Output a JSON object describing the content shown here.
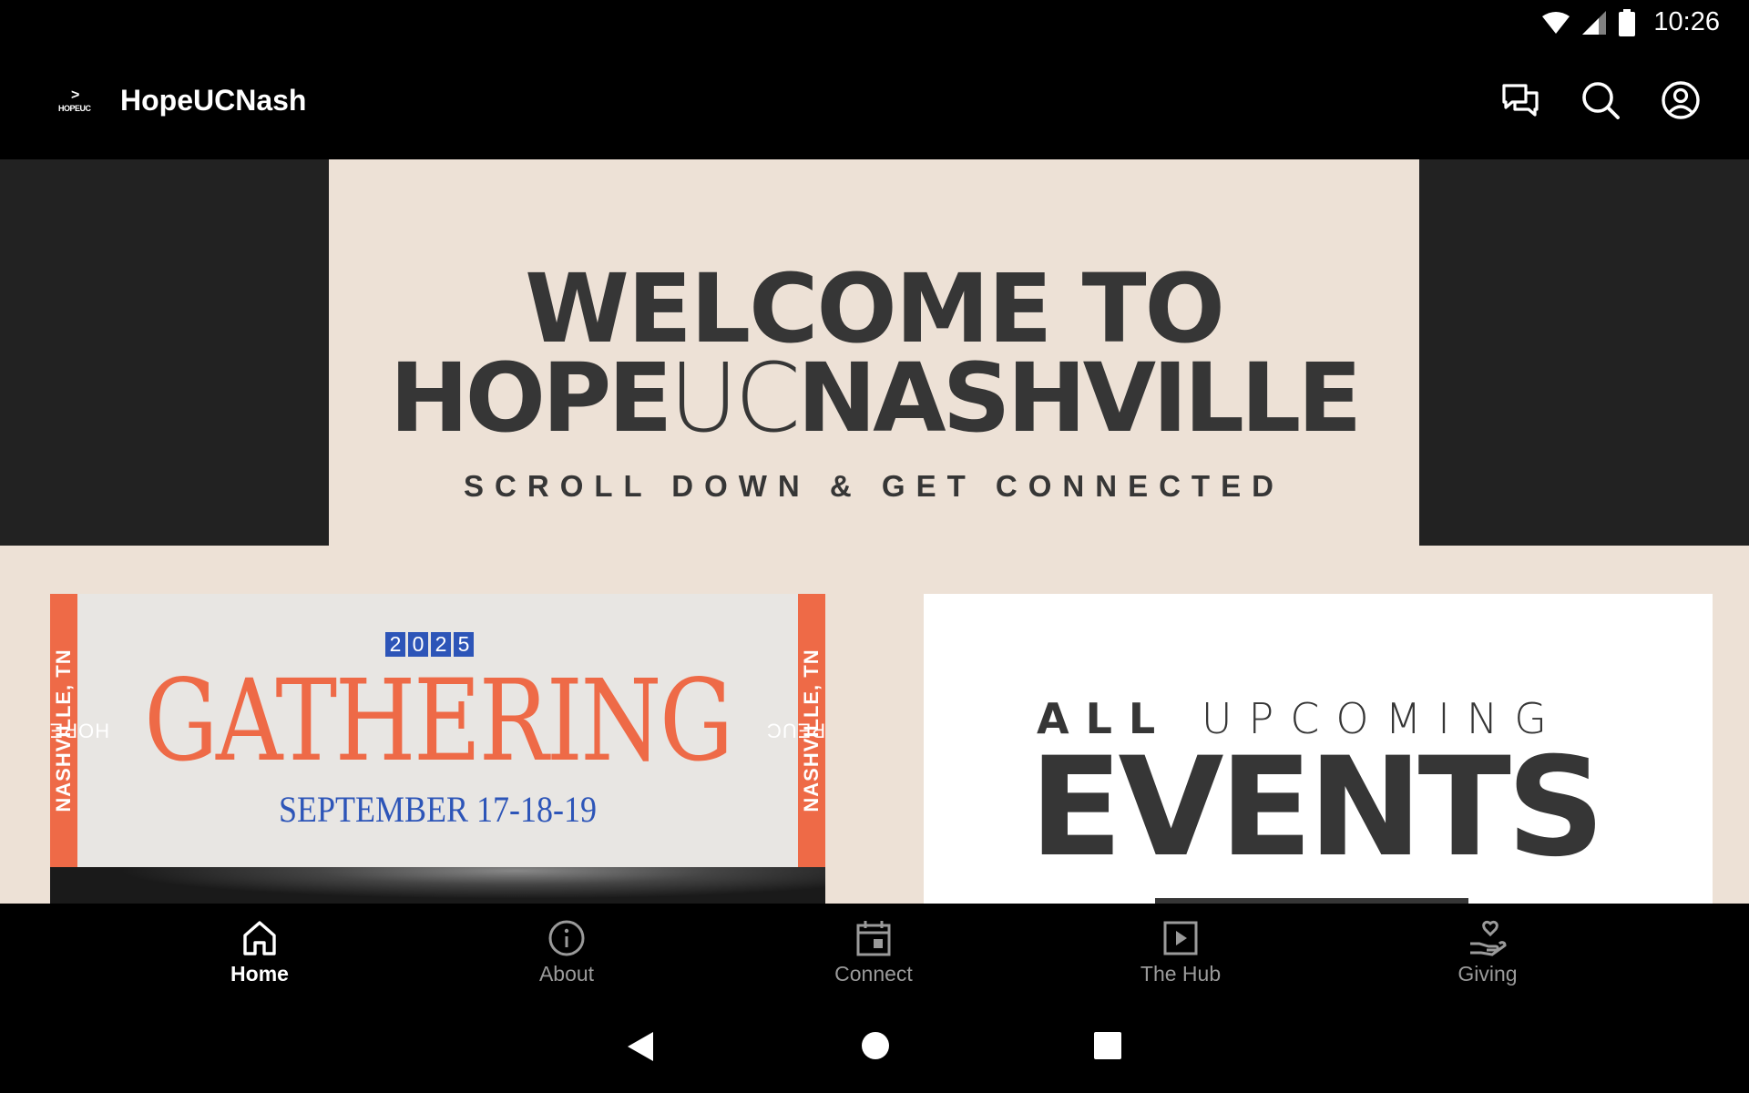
{
  "status_bar": {
    "time": "10:26"
  },
  "app_bar": {
    "logo_text": "HOPEUC",
    "title": "HopeUCNash"
  },
  "hero": {
    "line1": "WELCOME TO",
    "line2_bold_a": "HOPE",
    "line2_light": "UC",
    "line2_bold_b": "NASHVILLE",
    "subtitle": "SCROLL DOWN & GET CONNECTED"
  },
  "card_gathering": {
    "side_label_light": "HOPEUC ",
    "side_label_bold": "NASHVILLE, TN",
    "year_digits": [
      "2",
      "0",
      "2",
      "5"
    ],
    "title": "GATHERING",
    "date": "SEPTEMBER 17-18-19"
  },
  "card_events": {
    "line1_bold": "ALL",
    "line1_light": "UPCOMING",
    "line2": "EVENTS"
  },
  "bottom_nav": {
    "items": [
      {
        "label": "Home",
        "icon": "home-icon",
        "active": true
      },
      {
        "label": "About",
        "icon": "info-icon",
        "active": false
      },
      {
        "label": "Connect",
        "icon": "calendar-icon",
        "active": false
      },
      {
        "label": "The Hub",
        "icon": "play-icon",
        "active": false
      },
      {
        "label": "Giving",
        "icon": "giving-hand-icon",
        "active": false
      }
    ]
  },
  "colors": {
    "accent_orange": "#ee6a47",
    "accent_blue": "#2d55b8",
    "hero_bg": "#ede1d6",
    "text_dark": "#363636"
  }
}
